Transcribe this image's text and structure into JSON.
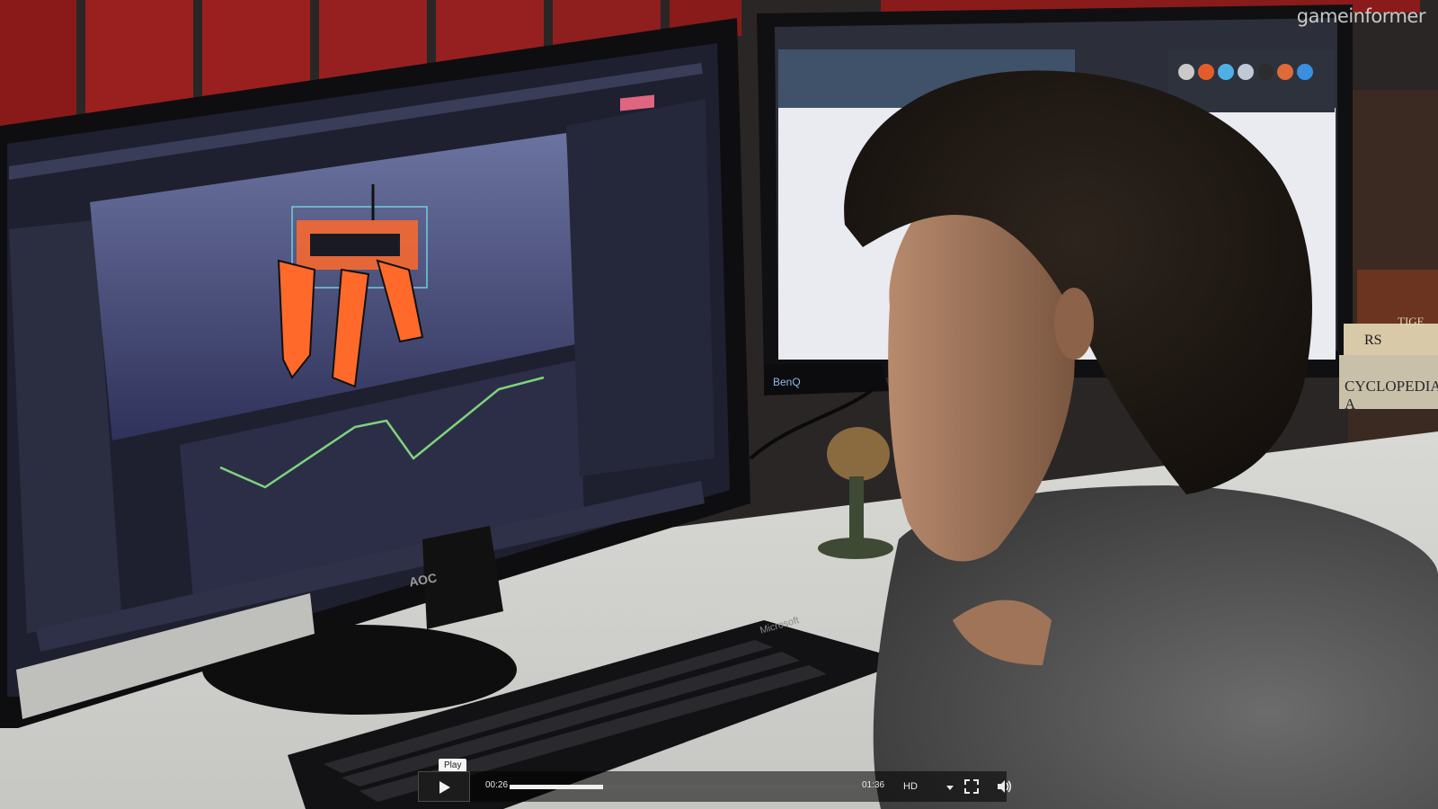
{
  "video": {
    "watermark": "gameinformer",
    "monitor_brand_left": "AOC",
    "monitor_brand_right": "BenQ",
    "keyboard_brand": "Microsoft",
    "book_spine_1": "TIGE",
    "book_spine_2": "RS",
    "book_spine_3": "CYCLOPEDIA A"
  },
  "player": {
    "tooltip": "Play",
    "current_time": "00:26",
    "duration": "01:36",
    "quality": "HD",
    "progress_fraction": 0.27,
    "icons": [
      "play-icon",
      "fullscreen-icon",
      "volume-icon",
      "chevron-down-icon"
    ]
  },
  "colors": {
    "accent": "#ff6a2b",
    "curve": "#7fd47a",
    "viewport_bg": "#4a4e77"
  }
}
